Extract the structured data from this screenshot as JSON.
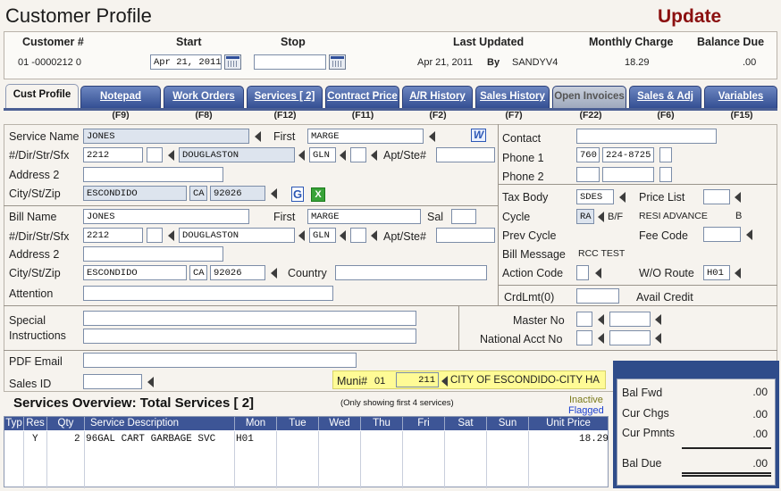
{
  "window": {
    "title": "Customer Profile",
    "mode": "Update"
  },
  "header": {
    "customer_label": "Customer #",
    "customer_value": "01 -0000212 0",
    "start_label": "Start",
    "start_value": "Apr 21, 2011",
    "stop_label": "Stop",
    "stop_value": "",
    "last_updated_label": "Last Updated",
    "last_updated_value": "Apr 21, 2011",
    "by_label": "By",
    "by_value": "SANDYV4",
    "monthly_label": "Monthly Charge",
    "monthly_value": "18.29",
    "balance_label": "Balance Due",
    "balance_value": ".00"
  },
  "tabs": [
    {
      "label": "Cust Profile",
      "key": "(F9)"
    },
    {
      "label": "Notepad",
      "key": "(F8)"
    },
    {
      "label": "Work Orders",
      "key": "(F12)"
    },
    {
      "label": "Services [    2]",
      "key": "(F11)"
    },
    {
      "label": "Contract Price",
      "key": "(F2)"
    },
    {
      "label": "A/R History",
      "key": "(F7)"
    },
    {
      "label": "Sales History",
      "key": "(F22)"
    },
    {
      "label": "Open Invoices",
      "key": "(F6)"
    },
    {
      "label": "Sales & Adj",
      "key": "(F15)"
    },
    {
      "label": "Variables",
      "key": ""
    }
  ],
  "service": {
    "name_label": "Service Name",
    "name": "JONES",
    "first_label": "First",
    "first": "MARGE",
    "addr_label": "#/Dir/Str/Sfx",
    "number": "2212",
    "dir": "",
    "street": "DOUGLASTON",
    "sfx": "GLN",
    "apt_label": "Apt/Ste#",
    "apt": "",
    "address2_label": "Address 2",
    "address2": "",
    "csz_label": "City/St/Zip",
    "city": "ESCONDIDO",
    "state": "CA",
    "zip": "92026"
  },
  "bill": {
    "name_label": "Bill Name",
    "name": "JONES",
    "first_label": "First",
    "first": "MARGE",
    "sal_label": "Sal",
    "sal": "",
    "addr_label": "#/Dir/Str/Sfx",
    "number": "2212",
    "dir": "",
    "street": "DOUGLASTON",
    "sfx": "GLN",
    "apt_label": "Apt/Ste#",
    "apt": "",
    "address2_label": "Address 2",
    "address2": "",
    "csz_label": "City/St/Zip",
    "city": "ESCONDIDO",
    "state": "CA",
    "zip": "92026",
    "country_label": "Country",
    "country": "",
    "attention_label": "Attention",
    "attention": ""
  },
  "contact": {
    "contact_label": "Contact",
    "contact": "",
    "phone1_label": "Phone 1",
    "phone1_area": "760",
    "phone1_num": "224-8725",
    "phone2_label": "Phone 2",
    "phone2_area": "",
    "phone2_num": ""
  },
  "account": {
    "tax_label": "Tax Body",
    "tax": "SDES",
    "price_list_label": "Price List",
    "price_list": "",
    "cycle_label": "Cycle",
    "cycle": "RA",
    "bf_label": "B/F",
    "cycle_desc": "RESI ADVANCE",
    "cycle_code": "B",
    "prev_cycle_label": "Prev Cycle",
    "fee_code_label": "Fee Code",
    "fee_code": "",
    "bill_message_label": "Bill Message",
    "bill_message": "RCC TEST",
    "action_code_label": "Action Code",
    "action_code": "",
    "wo_route_label": "W/O Route",
    "wo_route": "H01",
    "crdlmt_label": "CrdLmt(0)",
    "crdlmt": "",
    "avail_credit_label": "Avail Credit"
  },
  "special": {
    "label1": "Special",
    "label2": "Instructions",
    "master_label": "Master No",
    "national_label": "National Acct No"
  },
  "pdf_email_label": "PDF Email",
  "pdf_email": "",
  "sales_id_label": "Sales ID",
  "sales_id": "",
  "muni": {
    "label": "Muni#",
    "prefix": "01",
    "code": "211",
    "name": "CITY OF ESCONDIDO-CITY HA"
  },
  "services_overview": {
    "title": "Services Overview: Total Services [    2]",
    "note": "(Only showing first 4 services)",
    "inactive": "Inactive",
    "flagged": "Flagged",
    "columns": [
      "Typ",
      "Res",
      "Qty",
      "Service Description",
      "Mon",
      "Tue",
      "Wed",
      "Thu",
      "Fri",
      "Sat",
      "Sun",
      "Unit Price"
    ],
    "rows": [
      {
        "typ": "",
        "res": "Y",
        "qty": "2",
        "desc": "96GAL CART GARBAGE SVC",
        "mon": "H01",
        "tue": "",
        "wed": "",
        "thu": "",
        "fri": "",
        "sat": "",
        "sun": "",
        "price": "18.29"
      }
    ]
  },
  "totals": {
    "bal_fwd_label": "Bal Fwd",
    "bal_fwd": ".00",
    "cur_chgs_label": "Cur Chgs",
    "cur_chgs": ".00",
    "cur_pmnts_label": "Cur Pmnts",
    "cur_pmnts": ".00",
    "bal_due_label": "Bal Due",
    "bal_due": ".00"
  },
  "colors": {
    "tab": "#344f93",
    "mode": "#8b1010",
    "muni_bg": "#fffb96",
    "flagged": "#1a3fd0",
    "inactive": "#7a7a1a"
  }
}
